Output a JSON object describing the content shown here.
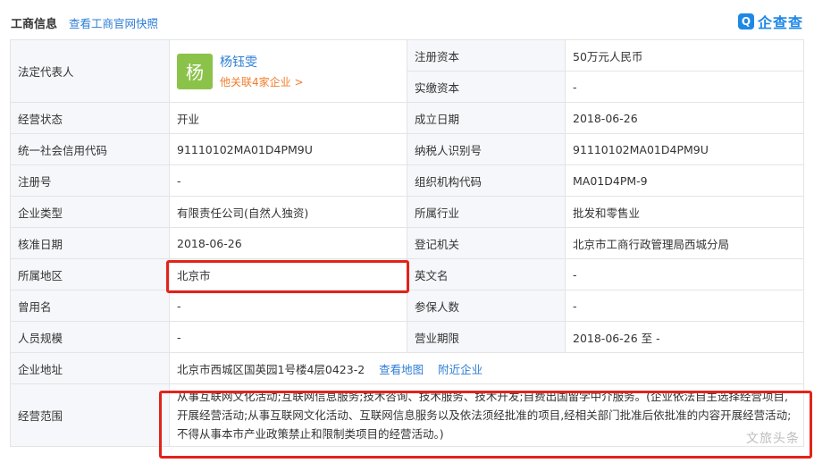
{
  "header": {
    "title": "工商信息",
    "link": "查看工商官网快照",
    "logo_mark": "Q",
    "logo_text": "企查查"
  },
  "legal_rep": {
    "label": "法定代表人",
    "avatar": "杨",
    "name": "杨钰雯",
    "related": "他关联4家企业 >"
  },
  "rows": {
    "registered_capital": {
      "label": "注册资本",
      "value": "50万元人民币"
    },
    "paid_capital": {
      "label": "实缴资本",
      "value": "-"
    },
    "status": {
      "label": "经营状态",
      "value": "开业"
    },
    "founded": {
      "label": "成立日期",
      "value": "2018-06-26"
    },
    "credit_code": {
      "label": "统一社会信用代码",
      "value": "91110102MA01D4PM9U"
    },
    "taxpayer_id": {
      "label": "纳税人识别号",
      "value": "91110102MA01D4PM9U"
    },
    "reg_no": {
      "label": "注册号",
      "value": "-"
    },
    "org_code": {
      "label": "组织机构代码",
      "value": "MA01D4PM-9"
    },
    "company_type": {
      "label": "企业类型",
      "value": "有限责任公司(自然人独资)"
    },
    "industry": {
      "label": "所属行业",
      "value": "批发和零售业"
    },
    "approval_date": {
      "label": "核准日期",
      "value": "2018-06-26"
    },
    "authority": {
      "label": "登记机关",
      "value": "北京市工商行政管理局西城分局"
    },
    "region": {
      "label": "所属地区",
      "value": "北京市"
    },
    "english_name": {
      "label": "英文名",
      "value": "-"
    },
    "former_name": {
      "label": "曾用名",
      "value": "-"
    },
    "insured": {
      "label": "参保人数",
      "value": "-"
    },
    "staff_size": {
      "label": "人员规模",
      "value": "-"
    },
    "term": {
      "label": "营业期限",
      "value": "2018-06-26 至 -"
    },
    "address": {
      "label": "企业地址",
      "value": "北京市西城区国英园1号楼4层0423-2",
      "map_link": "查看地图",
      "nearby_link": "附近企业"
    },
    "scope": {
      "label": "经营范围",
      "value": "从事互联网文化活动;互联网信息服务;技术咨询、技术服务、技术开发;自费出国留学中介服务。(企业依法自主选择经营项目,开展经营活动;从事互联网文化活动、互联网信息服务以及依法须经批准的项目,经相关部门批准后依批准的内容开展经营活动;不得从事本市产业政策禁止和限制类项目的经营活动。)"
    }
  },
  "watermark": "文旅头条"
}
